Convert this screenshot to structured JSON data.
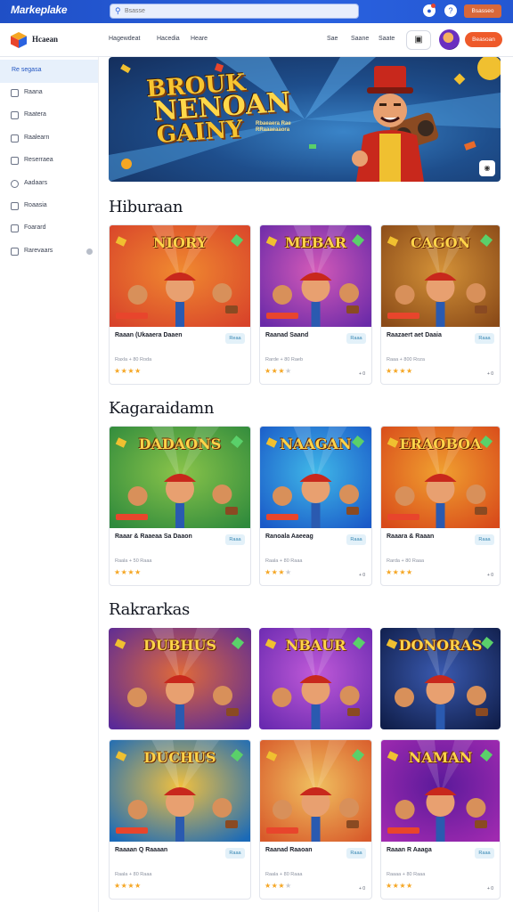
{
  "topbar": {
    "brand": "Markeplake",
    "search_placeholder": "Bsasse",
    "button": "Bsasseo",
    "icons": [
      "bell-icon",
      "help-icon"
    ]
  },
  "nav": {
    "title": "Hcaean",
    "links": [
      "Hagewdeat",
      "Hacedia",
      "Heare"
    ],
    "right_links": [
      "Sae",
      "Saane",
      "Saate"
    ],
    "cta": "Beasoan"
  },
  "sidebar": {
    "items": [
      {
        "label": "Re segasa",
        "active": true
      },
      {
        "label": "Raana"
      },
      {
        "label": "Raatera"
      },
      {
        "label": "Raalearn"
      },
      {
        "label": "Reserraea"
      },
      {
        "label": "Aadaars"
      },
      {
        "label": "Roaasia"
      },
      {
        "label": "Foarard"
      },
      {
        "label": "Rarevaars"
      }
    ]
  },
  "hero": {
    "title_line1": "BROUK",
    "title_line2": "NENOAN",
    "title_line3": "GAINY",
    "subtitle": "Rbaeaera Rae\nRRaaaeaaora"
  },
  "sections": [
    {
      "title": "Hiburaan",
      "cards": [
        {
          "name": "Raaan (Ukaaera Daaen",
          "chip": "Reaa",
          "meta": "Raxla + 80 Roda",
          "rating": 4,
          "count": "",
          "art": "NIORY",
          "palette": [
            "#d8432a",
            "#f08a30"
          ]
        },
        {
          "name": "Raanad Saand",
          "chip": "Raaa",
          "meta": "Rarde + 80 Raeb",
          "rating": 3,
          "count": "+ 0",
          "art": "MEBAR",
          "palette": [
            "#6a2aa8",
            "#d45ab8"
          ]
        },
        {
          "name": "Raazaert aet Daaia",
          "chip": "Raaa",
          "meta": "Raaa + 800 Roza",
          "rating": 4,
          "count": "+ 0",
          "art": "CAGON",
          "palette": [
            "#8a4a18",
            "#d49238"
          ]
        }
      ]
    },
    {
      "title": "Kagaraidamn",
      "cards": [
        {
          "name": "Raaar & Raaeaa Sa Daaon",
          "chip": "Raaa",
          "meta": "Raala + 50 Raaa",
          "rating": 4,
          "count": "",
          "art": "DADAONS",
          "palette": [
            "#2f8a3c",
            "#8ac44a"
          ]
        },
        {
          "name": "Ranoala Aaeeag",
          "chip": "Raaa",
          "meta": "Raala + 80 Raaa",
          "rating": 3,
          "count": "+ 0",
          "art": "NAAGAN",
          "palette": [
            "#1a5ac8",
            "#40b8e8"
          ]
        },
        {
          "name": "Raaara & Raaan",
          "chip": "Raaa",
          "meta": "Rarda + 80 Raaa",
          "rating": 4,
          "count": "+ 0",
          "art": "ERAOBOA",
          "palette": [
            "#d84a1a",
            "#f0a030"
          ]
        }
      ]
    },
    {
      "title": "Rakrarkas",
      "tiles": [
        {
          "art": "DUBHUS",
          "palette": [
            "#5a2a98",
            "#e06a3a"
          ]
        },
        {
          "art": "NBAUR",
          "palette": [
            "#6a2ab0",
            "#c05ad8"
          ]
        },
        {
          "art": "DONORAS",
          "palette": [
            "#101e4a",
            "#3a5ab0"
          ]
        }
      ],
      "cards": [
        {
          "name": "Raaaan Q Raaaan",
          "chip": "Raaa",
          "meta": "Raala + 80 Raaa",
          "rating": 4,
          "count": "",
          "art": "DUCHUS",
          "palette": [
            "#1a6ab8",
            "#f0c040"
          ]
        },
        {
          "name": "Raanad Raaoan",
          "chip": "Raaa",
          "meta": "Raala + 80 Raaa",
          "rating": 3,
          "count": "+ 0",
          "art": "",
          "palette": [
            "#d85a2a",
            "#f0c060"
          ]
        },
        {
          "name": "Raaan R Aaaga",
          "chip": "Raaa",
          "meta": "Raaaa + 80 Raaa",
          "rating": 4,
          "count": "+ 0",
          "art": "NAMAN",
          "palette": [
            "#a02ab0",
            "#5a1a9a"
          ]
        }
      ]
    }
  ],
  "colors": {
    "topbar": "#2457d2",
    "accent": "#ee5a2a",
    "star": "#f5a623",
    "chip_bg": "#e3f1f9",
    "active_side": "#e7f0fb"
  }
}
